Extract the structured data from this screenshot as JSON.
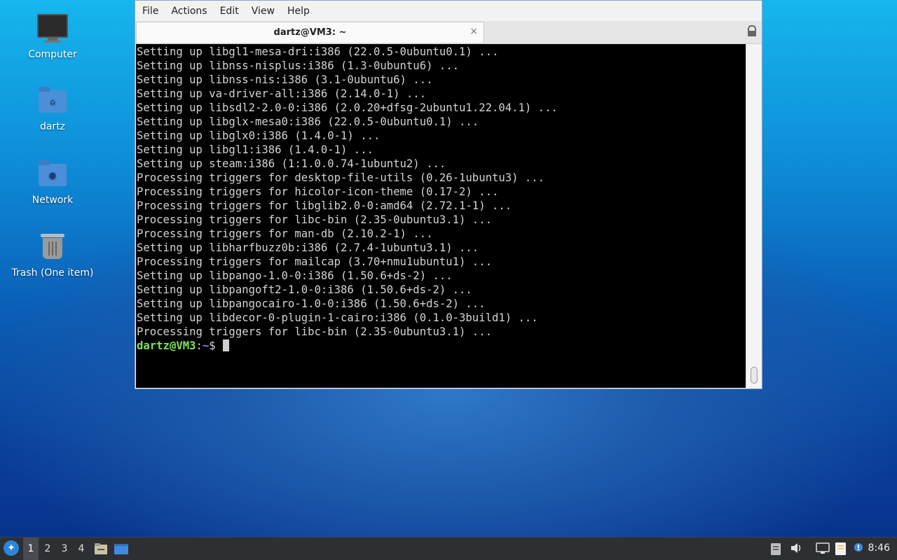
{
  "desktop": {
    "icons": [
      {
        "label": "Computer"
      },
      {
        "label": "dartz"
      },
      {
        "label": "Network"
      },
      {
        "label": "Trash (One item)"
      }
    ]
  },
  "window": {
    "menu": [
      "File",
      "Actions",
      "Edit",
      "View",
      "Help"
    ],
    "tab_title": "dartz@VM3: ~",
    "tab_close": "×"
  },
  "terminal": {
    "lines": [
      "Setting up libgl1-mesa-dri:i386 (22.0.5-0ubuntu0.1) ...",
      "Setting up libnss-nisplus:i386 (1.3-0ubuntu6) ...",
      "Setting up libnss-nis:i386 (3.1-0ubuntu6) ...",
      "Setting up va-driver-all:i386 (2.14.0-1) ...",
      "Setting up libsdl2-2.0-0:i386 (2.0.20+dfsg-2ubuntu1.22.04.1) ...",
      "Setting up libglx-mesa0:i386 (22.0.5-0ubuntu0.1) ...",
      "Setting up libglx0:i386 (1.4.0-1) ...",
      "Setting up libgl1:i386 (1.4.0-1) ...",
      "Setting up steam:i386 (1:1.0.0.74-1ubuntu2) ...",
      "Processing triggers for desktop-file-utils (0.26-1ubuntu3) ...",
      "Processing triggers for hicolor-icon-theme (0.17-2) ...",
      "Processing triggers for libglib2.0-0:amd64 (2.72.1-1) ...",
      "Processing triggers for libc-bin (2.35-0ubuntu3.1) ...",
      "Processing triggers for man-db (2.10.2-1) ...",
      "Setting up libharfbuzz0b:i386 (2.7.4-1ubuntu3.1) ...",
      "Processing triggers for mailcap (3.70+nmu1ubuntu1) ...",
      "Setting up libpango-1.0-0:i386 (1.50.6+ds-2) ...",
      "Setting up libpangoft2-1.0-0:i386 (1.50.6+ds-2) ...",
      "Setting up libpangocairo-1.0-0:i386 (1.50.6+ds-2) ...",
      "Setting up libdecor-0-plugin-1-cairo:i386 (0.1.0-3build1) ...",
      "Processing triggers for libc-bin (2.35-0ubuntu3.1) ..."
    ],
    "prompt_user": "dartz@VM3",
    "prompt_sep": ":",
    "prompt_path": "~",
    "prompt_symbol": "$ "
  },
  "taskbar": {
    "workspaces": [
      "1",
      "2",
      "3",
      "4"
    ],
    "active_workspace": "1",
    "clock": "8:46",
    "icons": [
      "start-menu-icon",
      "file-manager-icon",
      "window-icon",
      "clipboard-icon",
      "volume-icon",
      "network-icon",
      "notes-icon",
      "notification-icon"
    ]
  },
  "colors": {
    "prompt_user": "#7fe35a",
    "prompt_path": "#6e8fe8",
    "terminal_bg": "#000000",
    "taskbar_bg": "#2e2f33"
  }
}
